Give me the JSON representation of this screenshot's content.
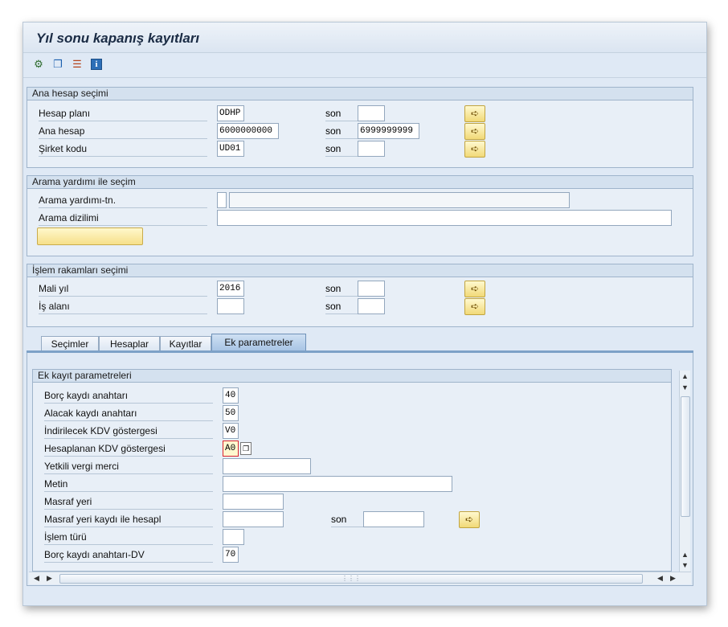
{
  "title": "Yıl sonu kapanış kayıtları",
  "toolbar": {
    "execute_icon": "execute-icon",
    "variant_icon": "get-variant-icon",
    "selection_icon": "selection-options-icon",
    "info_icon": "info-icon",
    "info_glyph": "i"
  },
  "son_label": "son",
  "groups": {
    "account": {
      "title": "Ana hesap seçimi",
      "rows": [
        {
          "label": "Hesap planı",
          "from": "ODHP",
          "to": ""
        },
        {
          "label": "Ana hesap",
          "from": "6000000000",
          "to": "6999999999"
        },
        {
          "label": "Şirket kodu",
          "from": "UD01",
          "to": ""
        }
      ]
    },
    "search": {
      "title": "Arama yardımı ile seçim",
      "help_id_label": "Arama yardımı-tn.",
      "help_id_value": "",
      "help_text_value": "",
      "string_label": "Arama dizilimi",
      "string_value": "",
      "button_label": ""
    },
    "txn": {
      "title": "İşlem rakamları seçimi",
      "rows": [
        {
          "label": "Mali yıl",
          "from": "2016",
          "to": ""
        },
        {
          "label": "İş alanı",
          "from": "",
          "to": ""
        }
      ]
    }
  },
  "tabs": [
    {
      "label": "Seçimler",
      "active": false
    },
    {
      "label": "Hesaplar",
      "active": false
    },
    {
      "label": "Kayıtlar",
      "active": false
    },
    {
      "label": "Ek parametreler",
      "active": true
    }
  ],
  "extra": {
    "title": "Ek kayıt parametreleri",
    "rows": [
      {
        "label": "Borç kaydı anahtarı",
        "value": "40"
      },
      {
        "label": "Alacak kaydı anahtarı",
        "value": "50"
      },
      {
        "label": "İndirilecek KDV göstergesi",
        "value": "V0"
      },
      {
        "label": "Hesaplanan KDV göstergesi",
        "value": "A0"
      },
      {
        "label": "Yetkili vergi merci",
        "value": ""
      },
      {
        "label": "Metin",
        "value": ""
      },
      {
        "label": "Masraf yeri",
        "value": ""
      },
      {
        "label": "Masraf yeri kaydı ile hesapl",
        "value": "",
        "to": ""
      },
      {
        "label": "İşlem türü",
        "value": ""
      },
      {
        "label": "Borç kaydı anahtarı-DV",
        "value": "70"
      }
    ]
  },
  "colors": {
    "accent": "#7da1c7",
    "button_yellow": "#f1d978",
    "focus_border": "#d9232e"
  }
}
